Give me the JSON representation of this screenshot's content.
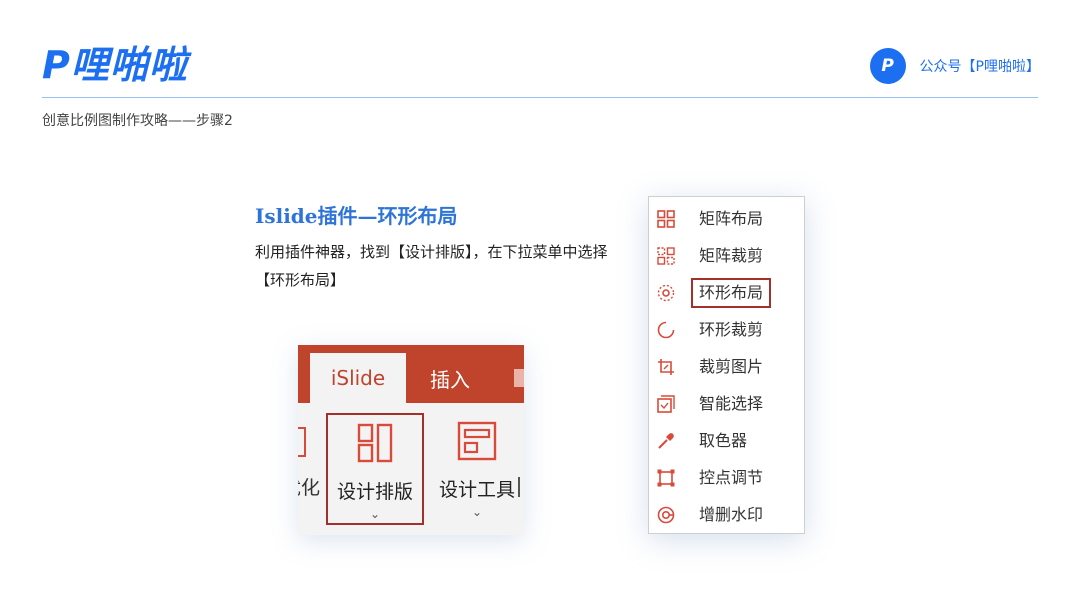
{
  "brand": {
    "logo_text": "P哩啪啦"
  },
  "account": {
    "avatar_glyph": "P",
    "label": "公众号【P哩啪啦】"
  },
  "subtitle": "创意比例图制作攻略——步骤2",
  "section": {
    "heading": "Islide插件—环形布局",
    "description": "利用插件神器，找到【设计排版】，在下拉菜单中选择【环形布局】"
  },
  "ribbon": {
    "tabs": [
      {
        "label": "iSlide",
        "active": true
      },
      {
        "label": "插入",
        "active": false
      }
    ],
    "prev_button_label": "优化",
    "buttons": [
      {
        "label": "设计排版",
        "selected": true,
        "icon": "grid-layout-icon"
      },
      {
        "label": "设计工具",
        "selected": false,
        "icon": "design-tools-icon"
      }
    ],
    "caret": "⌄"
  },
  "menu": {
    "items": [
      {
        "label": "矩阵布局",
        "icon": "matrix-layout-icon"
      },
      {
        "label": "矩阵裁剪",
        "icon": "matrix-crop-icon"
      },
      {
        "label": "环形布局",
        "icon": "ring-layout-icon",
        "highlighted": true
      },
      {
        "label": "环形裁剪",
        "icon": "ring-crop-icon"
      },
      {
        "label": "裁剪图片",
        "icon": "crop-image-icon"
      },
      {
        "label": "智能选择",
        "icon": "smart-select-icon"
      },
      {
        "label": "取色器",
        "icon": "color-picker-icon"
      },
      {
        "label": "控点调节",
        "icon": "handle-adjust-icon"
      },
      {
        "label": "增删水印",
        "icon": "watermark-icon"
      }
    ]
  },
  "colors": {
    "brand_blue": "#1d6ff2",
    "islide_red": "#c0442c",
    "icon_red": "#d84a3a",
    "highlight_border": "#a3302a"
  }
}
